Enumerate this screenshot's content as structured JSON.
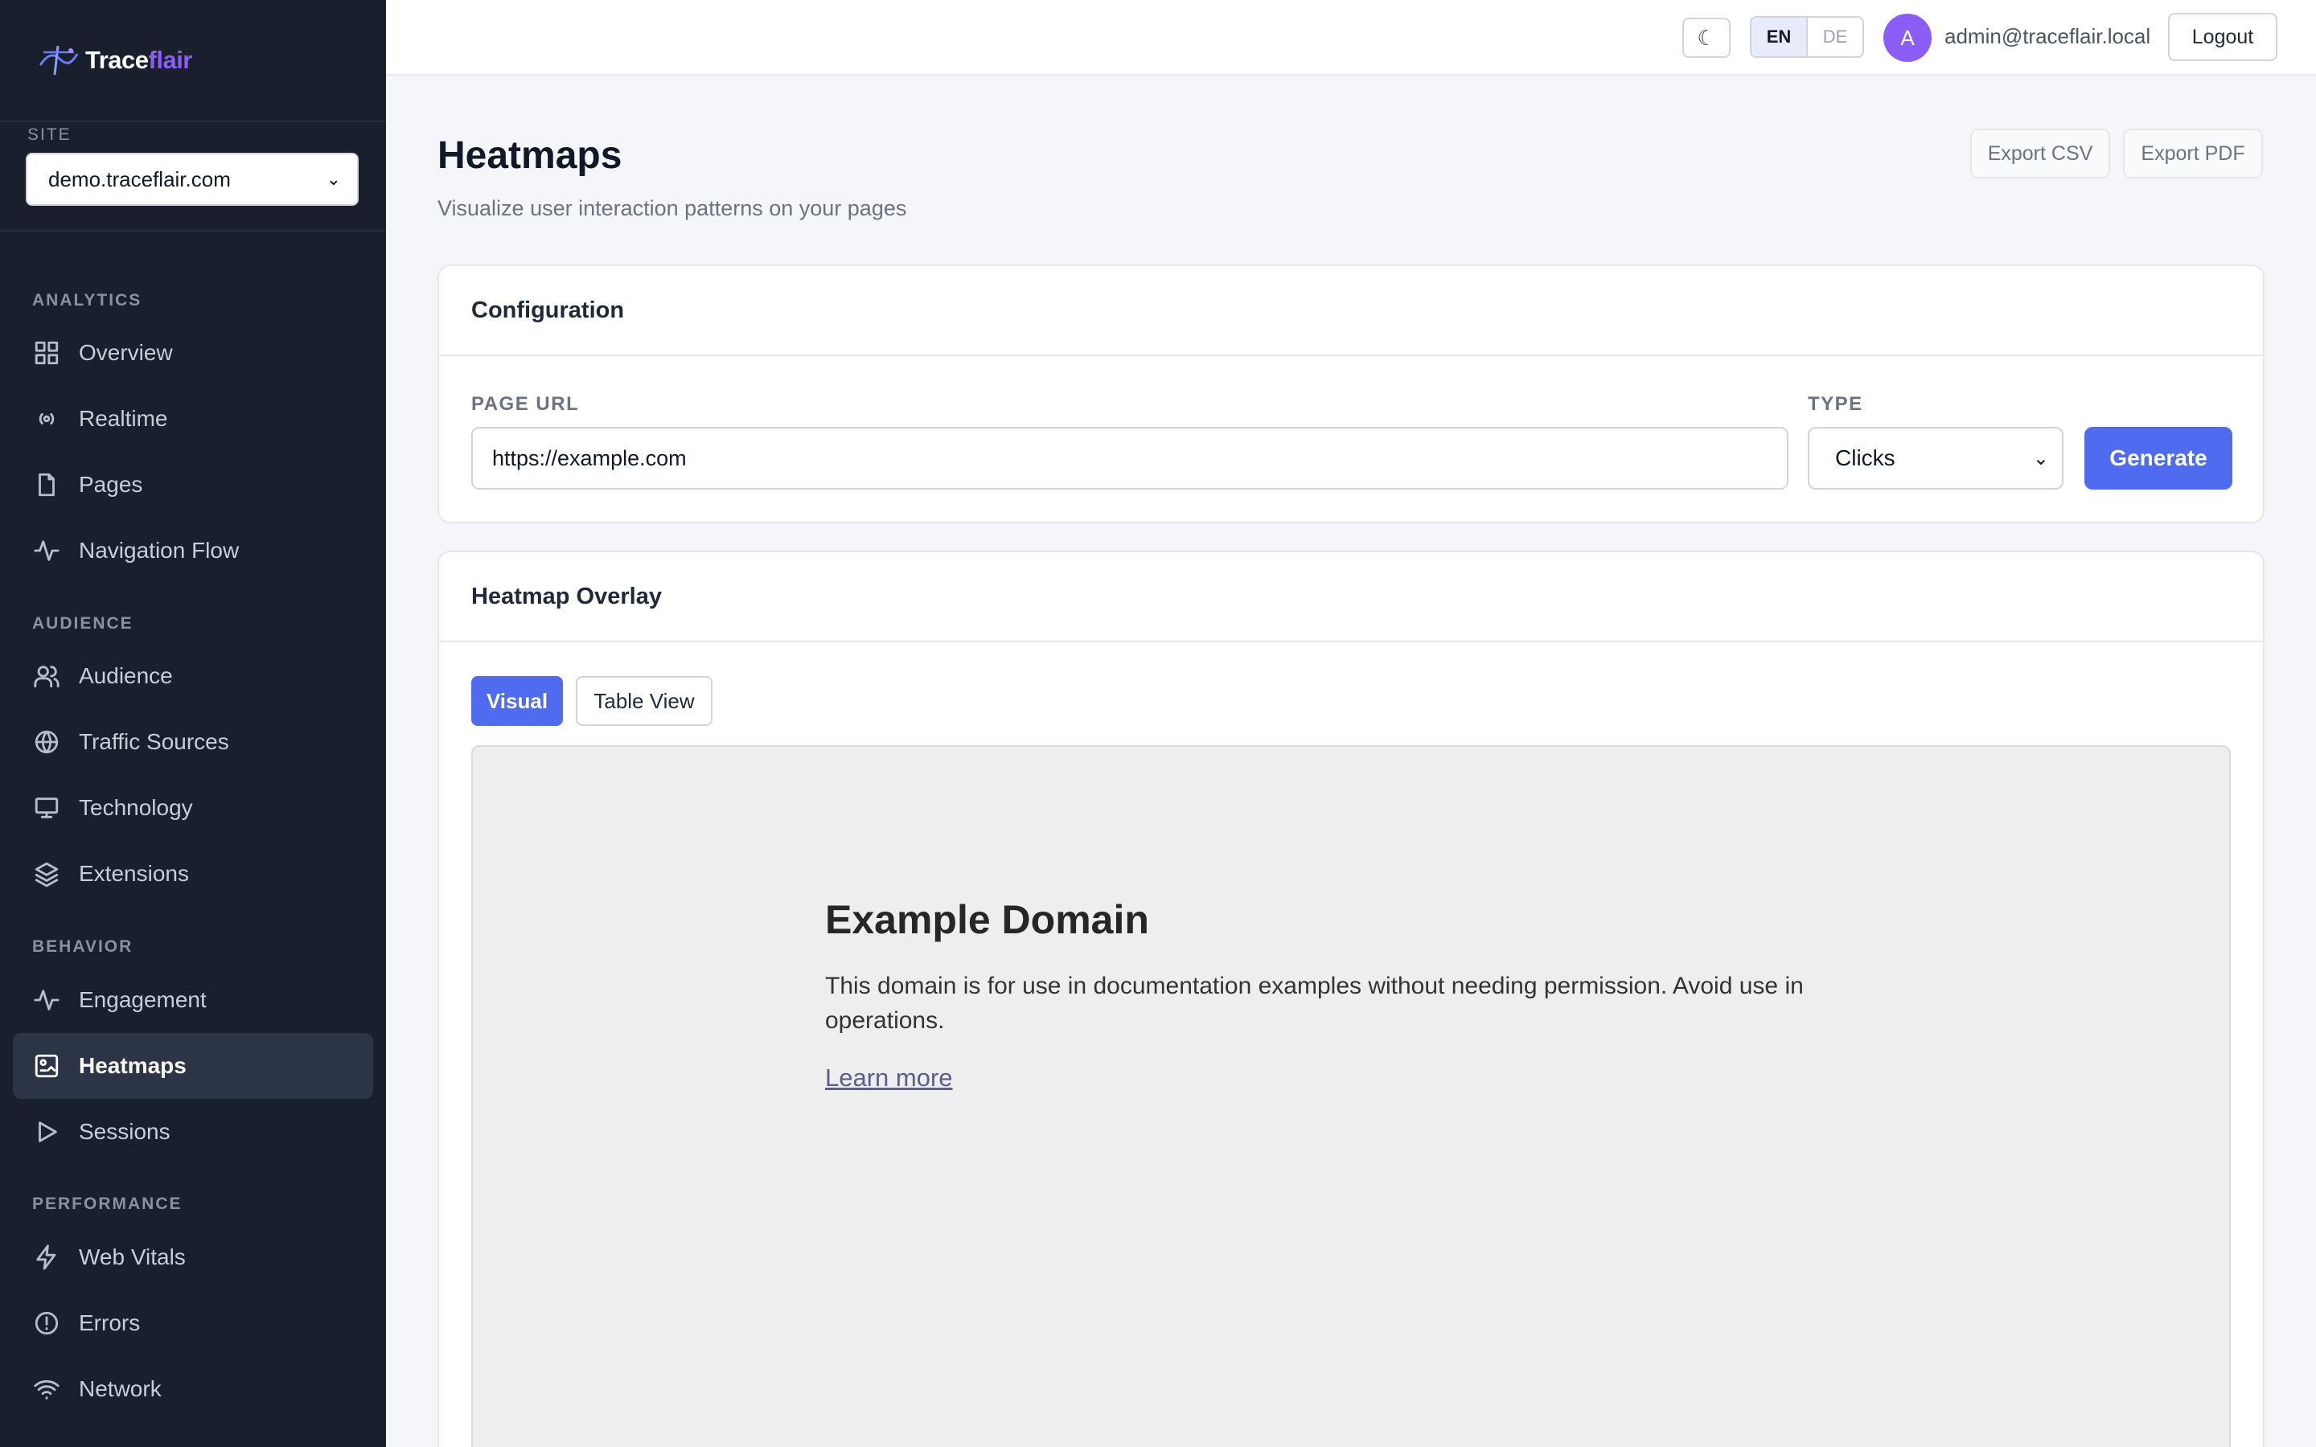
{
  "app": {
    "logo_part1": "Trace",
    "logo_part2": "flair"
  },
  "site": {
    "label": "SITE",
    "selected": "demo.traceflair.com"
  },
  "nav": {
    "sections": {
      "analytics": "ANALYTICS",
      "audience": "AUDIENCE",
      "behavior": "BEHAVIOR",
      "performance": "PERFORMANCE"
    },
    "items": {
      "overview": "Overview",
      "realtime": "Realtime",
      "pages": "Pages",
      "navigation_flow": "Navigation Flow",
      "audience": "Audience",
      "traffic_sources": "Traffic Sources",
      "technology": "Technology",
      "extensions": "Extensions",
      "engagement": "Engagement",
      "heatmaps": "Heatmaps",
      "sessions": "Sessions",
      "web_vitals": "Web Vitals",
      "errors": "Errors",
      "network": "Network"
    },
    "active": "heatmaps"
  },
  "topbar": {
    "theme_icon": "moon-icon",
    "theme_glyph": "☾",
    "lang_en": "EN",
    "lang_de": "DE",
    "avatar_initial": "A",
    "email": "admin@traceflair.local",
    "logout": "Logout"
  },
  "page": {
    "title": "Heatmaps",
    "subtitle": "Visualize user interaction patterns on your pages",
    "export_csv": "Export CSV",
    "export_pdf": "Export PDF"
  },
  "config": {
    "title": "Configuration",
    "url_label": "PAGE URL",
    "url_value": "https://example.com",
    "type_label": "TYPE",
    "type_value": "Clicks",
    "generate": "Generate"
  },
  "overlay": {
    "title": "Heatmap Overlay",
    "tab_visual": "Visual",
    "tab_table": "Table View",
    "preview_title": "Example Domain",
    "preview_body": "This domain is for use in documentation examples without needing permission. Avoid use in operations.",
    "preview_link": "Learn more"
  },
  "colors": {
    "sidebar_bg": "#1a1f2e",
    "accent": "#4f6cf0",
    "brand_purple": "#8b5cf6"
  }
}
